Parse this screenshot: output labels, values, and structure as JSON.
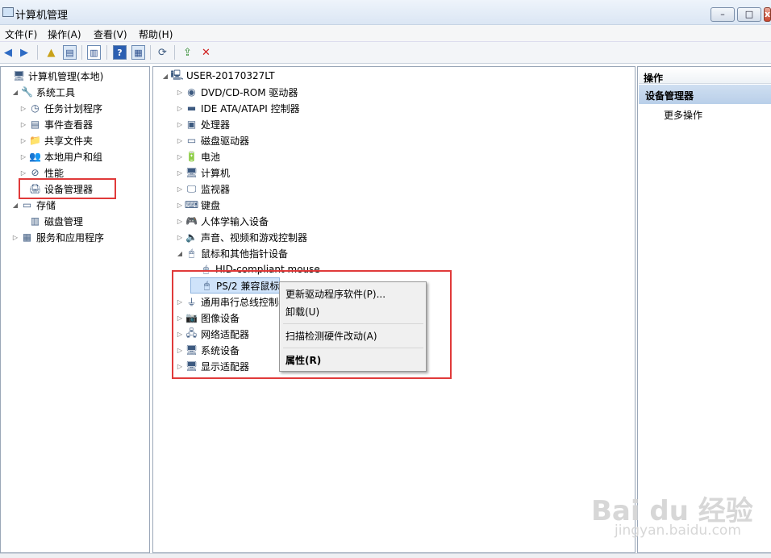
{
  "window": {
    "title": "计算机管理",
    "min": "–",
    "max": "□",
    "close": "x"
  },
  "menu": [
    "文件(F)",
    "操作(A)",
    "查看(V)",
    "帮助(H)"
  ],
  "left_tree": [
    {
      "label": "计算机管理(本地)",
      "icon": "computer-management-icon",
      "glyph": "🖥",
      "arrow": "",
      "indent": 0
    },
    {
      "label": "系统工具",
      "icon": "tools-icon",
      "glyph": "🔧",
      "arrow": "◢",
      "indent": 1
    },
    {
      "label": "任务计划程序",
      "icon": "clock-icon",
      "glyph": "◷",
      "arrow": "▷",
      "indent": 2
    },
    {
      "label": "事件查看器",
      "icon": "event-viewer-icon",
      "glyph": "▤",
      "arrow": "▷",
      "indent": 2
    },
    {
      "label": "共享文件夹",
      "icon": "shared-folder-icon",
      "glyph": "📁",
      "arrow": "▷",
      "indent": 2
    },
    {
      "label": "本地用户和组",
      "icon": "users-icon",
      "glyph": "👥",
      "arrow": "▷",
      "indent": 2
    },
    {
      "label": "性能",
      "icon": "performance-icon",
      "glyph": "⊘",
      "arrow": "▷",
      "indent": 2
    },
    {
      "label": "设备管理器",
      "icon": "device-manager-icon",
      "glyph": "🖨",
      "arrow": "",
      "indent": 2
    },
    {
      "label": "存储",
      "icon": "storage-icon",
      "glyph": "▭",
      "arrow": "◢",
      "indent": 1
    },
    {
      "label": "磁盘管理",
      "icon": "disk-management-icon",
      "glyph": "▥",
      "arrow": "",
      "indent": 2
    },
    {
      "label": "服务和应用程序",
      "icon": "services-icon",
      "glyph": "▦",
      "arrow": "▷",
      "indent": 1
    }
  ],
  "device_tree": [
    {
      "label": "USER-20170327LT",
      "icon": "computer-icon",
      "glyph": "🖳",
      "arrow": "◢",
      "indent": 0
    },
    {
      "label": "DVD/CD-ROM 驱动器",
      "icon": "dvd-drive-icon",
      "glyph": "◉",
      "arrow": "▷",
      "indent": 1
    },
    {
      "label": "IDE ATA/ATAPI 控制器",
      "icon": "ide-controller-icon",
      "glyph": "▬",
      "arrow": "▷",
      "indent": 1
    },
    {
      "label": "处理器",
      "icon": "processor-icon",
      "glyph": "▣",
      "arrow": "▷",
      "indent": 1
    },
    {
      "label": "磁盘驱动器",
      "icon": "disk-drive-icon",
      "glyph": "▭",
      "arrow": "▷",
      "indent": 1
    },
    {
      "label": "电池",
      "icon": "battery-icon",
      "glyph": "🔋",
      "arrow": "▷",
      "indent": 1
    },
    {
      "label": "计算机",
      "icon": "computer-icon",
      "glyph": "🖥",
      "arrow": "▷",
      "indent": 1
    },
    {
      "label": "监视器",
      "icon": "monitor-icon",
      "glyph": "🖵",
      "arrow": "▷",
      "indent": 1
    },
    {
      "label": "键盘",
      "icon": "keyboard-icon",
      "glyph": "⌨",
      "arrow": "▷",
      "indent": 1
    },
    {
      "label": "人体学输入设备",
      "icon": "hid-icon",
      "glyph": "🎮",
      "arrow": "▷",
      "indent": 1
    },
    {
      "label": "声音、视频和游戏控制器",
      "icon": "sound-icon",
      "glyph": "🔈",
      "arrow": "▷",
      "indent": 1
    },
    {
      "label": "鼠标和其他指针设备",
      "icon": "mouse-icon",
      "glyph": "🖱",
      "arrow": "◢",
      "indent": 1
    },
    {
      "label": "HID-compliant mouse",
      "icon": "mouse-icon",
      "glyph": "🖱",
      "arrow": "",
      "indent": 2
    },
    {
      "label": "PS/2 兼容鼠标",
      "icon": "mouse-icon",
      "glyph": "🖱",
      "arrow": "",
      "indent": 2
    },
    {
      "label": "通用串行总线控制器",
      "icon": "usb-icon",
      "glyph": "⏚",
      "arrow": "▷",
      "indent": 1
    },
    {
      "label": "图像设备",
      "icon": "camera-icon",
      "glyph": "📷",
      "arrow": "▷",
      "indent": 1
    },
    {
      "label": "网络适配器",
      "icon": "network-adapter-icon",
      "glyph": "🖧",
      "arrow": "▷",
      "indent": 1
    },
    {
      "label": "系统设备",
      "icon": "system-device-icon",
      "glyph": "🖥",
      "arrow": "▷",
      "indent": 1
    },
    {
      "label": "显示适配器",
      "icon": "display-adapter-icon",
      "glyph": "🖥",
      "arrow": "▷",
      "indent": 1
    }
  ],
  "actions": {
    "header": "操作",
    "section": "设备管理器",
    "more": "更多操作"
  },
  "context_menu": {
    "update": "更新驱动程序软件(P)...",
    "uninstall": "卸载(U)",
    "scan": "扫描检测硬件改动(A)",
    "properties": "属性(R)"
  },
  "watermark": {
    "brand": "Bai du 经验",
    "url": "jingyan.baidu.com"
  },
  "colors": {
    "highlight_red": "#e03a3a",
    "selection_blue": "#cfe3fa"
  }
}
